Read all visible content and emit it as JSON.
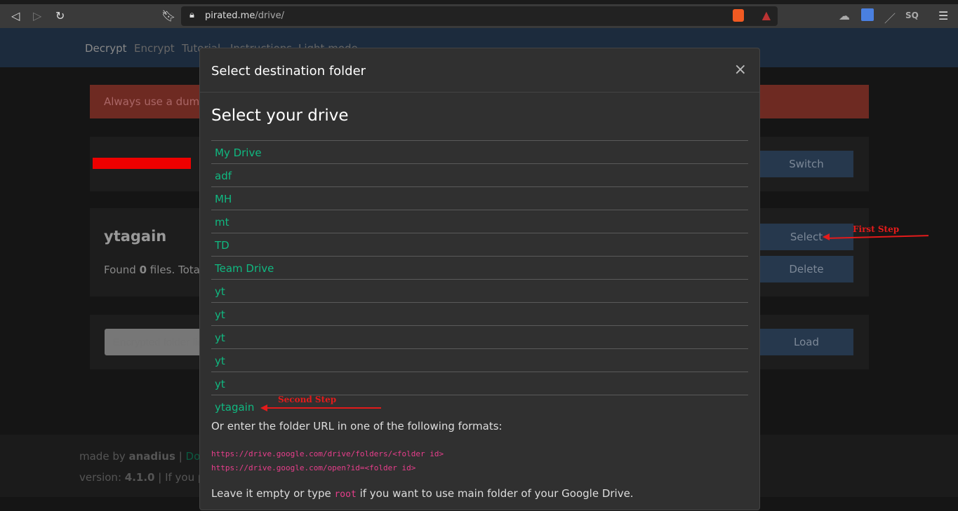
{
  "browser": {
    "url_host": "pirated.me",
    "url_path": "/drive/"
  },
  "nav": [
    "Decrypt",
    "Encrypt",
    "Tutorial",
    "Instructions",
    "Light mode"
  ],
  "alert": "Always use a dummy account",
  "account": {
    "switch_label": "Switch"
  },
  "folder": {
    "name": "ytagain",
    "found_prefix": "Found ",
    "count": "0",
    "found_suffix": " files. Total",
    "select_label": "Select",
    "delete_label": "Delete"
  },
  "load": {
    "placeholder": "Encrypted folder link",
    "load_label": "Load"
  },
  "footer": {
    "made_by": "made by ",
    "author": "anadius",
    "sep": " | ",
    "donate": "Donate",
    "version_label": "version: ",
    "version": "4.1.0",
    "paid": " | If you paid"
  },
  "modal": {
    "title": "Select destination folder",
    "close": "×",
    "heading": "Select your drive",
    "items": [
      "My Drive",
      "adf",
      "MH",
      "mt",
      "TD",
      "Team Drive",
      "yt",
      "yt",
      "yt",
      "yt",
      "yt",
      "ytagain"
    ],
    "or_text": "Or enter the folder URL in one of the following formats:",
    "url1": "https://drive.google.com/drive/folders/<folder id>",
    "url2": "https://drive.google.com/open?id=<folder id>",
    "leave_pre": "Leave it empty or type ",
    "leave_code": "root",
    "leave_post": " if you want to use main folder of your Google Drive."
  },
  "annotations": {
    "first": "First Step",
    "second": "Second Step"
  }
}
